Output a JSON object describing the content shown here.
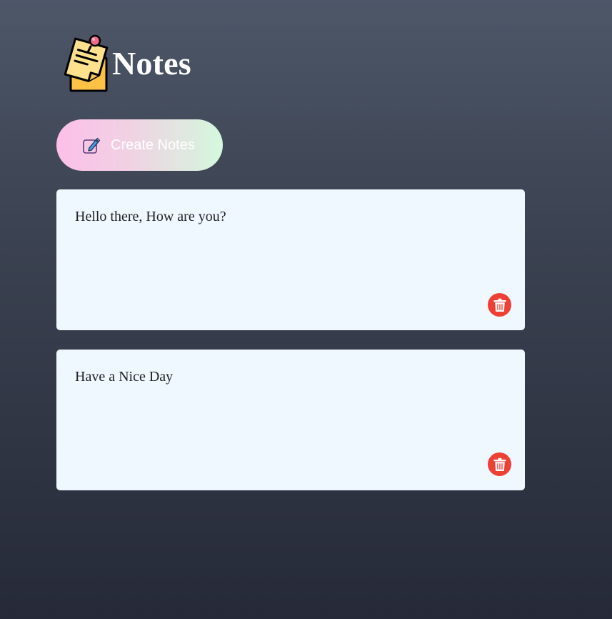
{
  "app": {
    "title": "Notes",
    "logo_icon": "sticky-note-icon"
  },
  "toolbar": {
    "create_label": "Create Notes",
    "create_icon": "pencil-edit-icon"
  },
  "notes": [
    {
      "text": "Hello there, How are you?",
      "delete_icon": "trash-icon"
    },
    {
      "text": "Have a Nice Day",
      "delete_icon": "trash-icon"
    }
  ],
  "colors": {
    "note_background": "#f0f8ff",
    "delete_button": "#ee4136",
    "button_gradient_start": "#fdbfe9",
    "button_gradient_end": "#d4f8dd"
  }
}
